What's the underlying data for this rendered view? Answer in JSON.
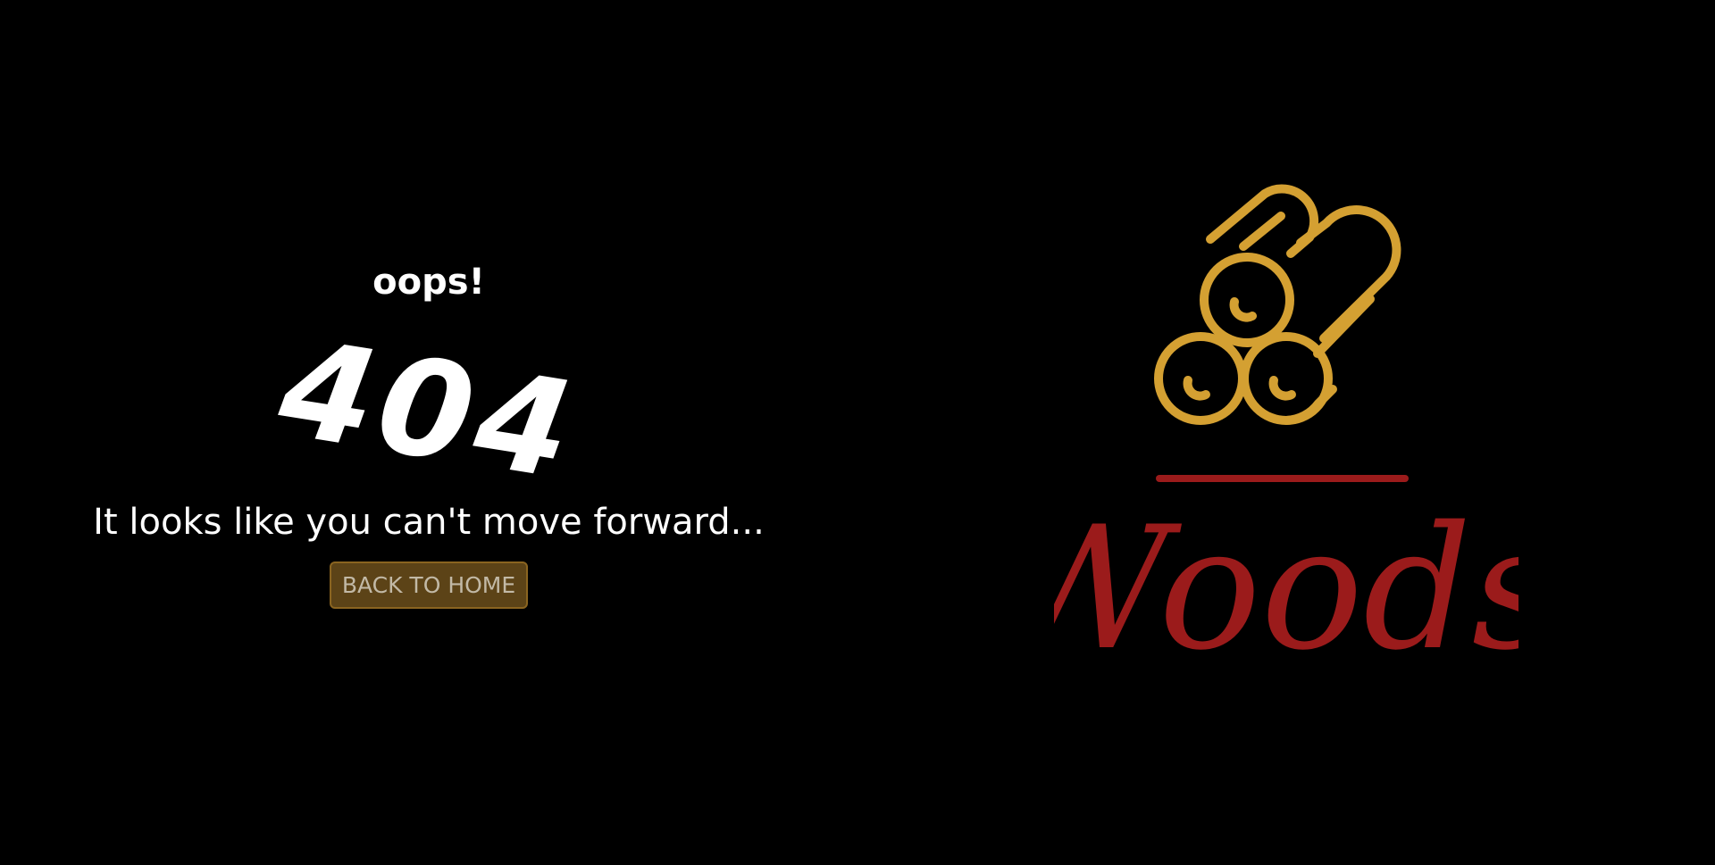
{
  "error": {
    "heading": "oops!",
    "code": "404",
    "message": "It looks like you can't move forward...",
    "home_button_label": "BACK TO HOME"
  },
  "brand": {
    "name": "Woods",
    "icon": "firewood-logs-icon"
  },
  "colors": {
    "background": "#000000",
    "text": "#ffffff",
    "accent_gold": "#d4a032",
    "brand_red": "#9b1b1b",
    "button_background": "#5c4317",
    "button_text": "#c2b9a6"
  }
}
